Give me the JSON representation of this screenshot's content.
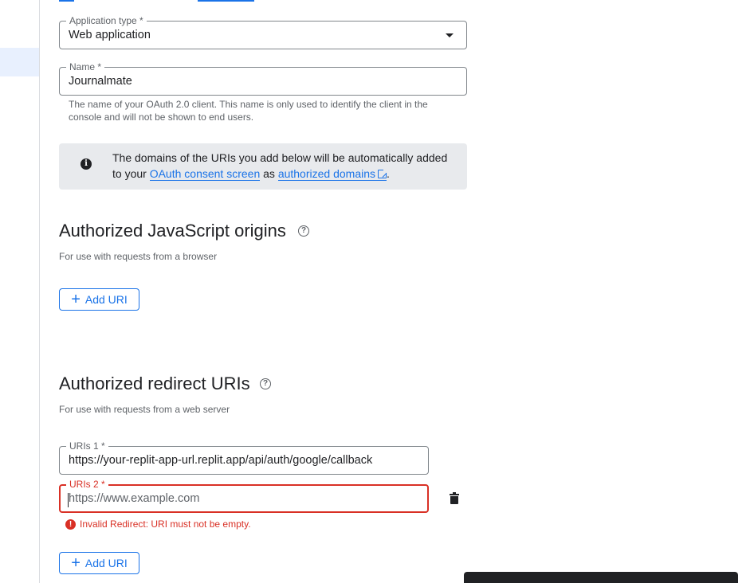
{
  "form": {
    "application_type": {
      "label": "Application type *",
      "value": "Web application"
    },
    "name": {
      "label": "Name *",
      "value": "Journalmate",
      "hint": "The name of your OAuth 2.0 client. This name is only used to identify the client in the console and will not be shown to end users."
    }
  },
  "banner": {
    "text_before": "The domains of the URIs you add below will be automatically added to your ",
    "link1": "OAuth consent screen",
    "text_middle": " as ",
    "link2": "authorized domains",
    "text_after": "."
  },
  "js_origins": {
    "title": "Authorized JavaScript origins",
    "subtitle": "For use with requests from a browser",
    "add_button": "Add URI"
  },
  "redirect_uris": {
    "title": "Authorized redirect URIs",
    "subtitle": "For use with requests from a web server",
    "uri1": {
      "label": "URIs 1 *",
      "value": "https://your-replit-app-url.replit.app/api/auth/google/callback"
    },
    "uri2": {
      "label": "URIs 2 *",
      "placeholder": "https://www.example.com"
    },
    "error": "Invalid Redirect: URI must not be empty.",
    "add_button": "Add URI"
  },
  "icons": {
    "info": "info-icon",
    "help": "help-icon",
    "add": "plus-icon",
    "delete": "trash-icon",
    "error": "error-icon",
    "external": "external-link-icon",
    "dropdown": "dropdown-arrow-icon"
  },
  "colors": {
    "accent": "#1a73e8",
    "error": "#d93025",
    "banner_bg": "#e8eaed",
    "nav_selected": "#e8f0fe"
  }
}
